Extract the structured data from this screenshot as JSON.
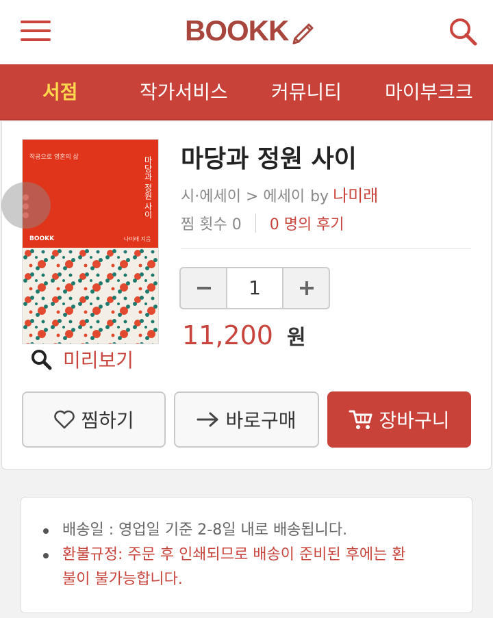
{
  "header": {
    "logo_text": "BOOKK",
    "menu_icon": "hamburger-icon",
    "search_icon": "search-icon",
    "brand_color": "#a8453c"
  },
  "nav": {
    "items": [
      {
        "label": "서점",
        "active": true
      },
      {
        "label": "작가서비스",
        "active": false
      },
      {
        "label": "커뮤니티",
        "active": false
      },
      {
        "label": "마이부크크",
        "active": false
      }
    ],
    "bg_color": "#c9423a",
    "active_color": "#ffd84d"
  },
  "book": {
    "title": "마당과 정원 사이",
    "category": "시·에세이 > 에세이",
    "by_label": "by",
    "author": "나미래",
    "wish_count_label": "찜 횟수 0",
    "review_label": "0 명의 후기",
    "preview_label": "미리보기",
    "cover": {
      "subtitle": "작공으로 영혼의 삶",
      "title": "마당과 정원 사이",
      "brand": "BOOKK",
      "author": "나미래 지음"
    }
  },
  "quantity": {
    "value": "1"
  },
  "price": {
    "value": "11,200",
    "unit": "원"
  },
  "actions": {
    "wish_label": "찜하기",
    "buy_now_label": "바로구매",
    "cart_label": "장바구니"
  },
  "notice": {
    "shipping": "배송일 : 영업일 기준 2-8일 내로 배송됩니다.",
    "refund_line1": "환불규정: 주문 후 인쇄되므로 배송이 준비된 후에는 환",
    "refund_line2": "불이 불가능합니다."
  }
}
